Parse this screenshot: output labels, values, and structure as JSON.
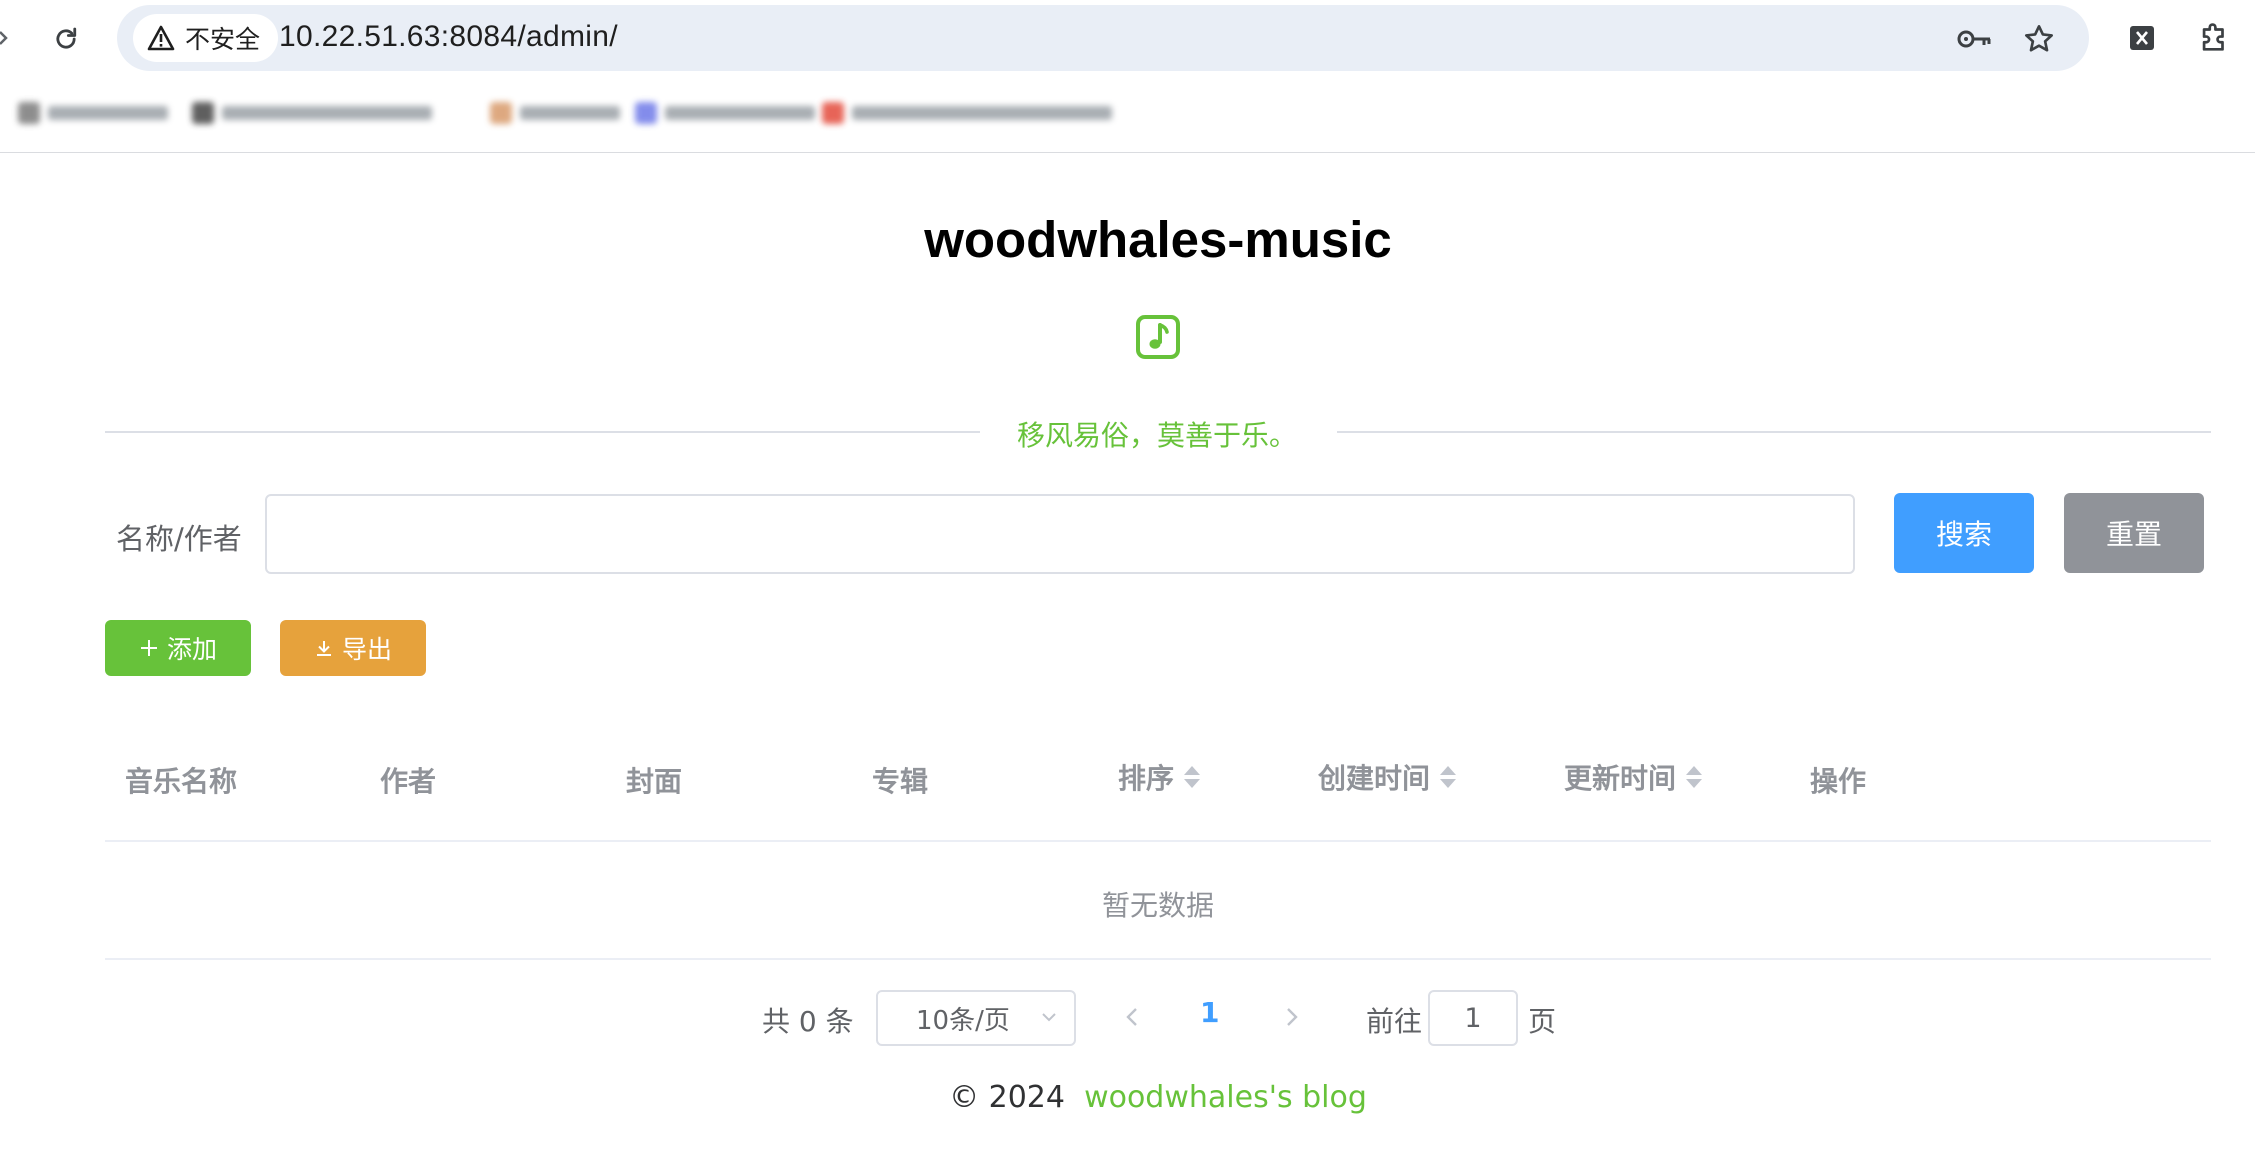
{
  "browser": {
    "security_label": "不安全",
    "url": "10.22.51.63:8084/admin/"
  },
  "site": {
    "title": "woodwhales-music",
    "motto": "移风易俗，莫善于乐。"
  },
  "search": {
    "label": "名称/作者",
    "value": "",
    "placeholder": "",
    "search_button": "搜索",
    "reset_button": "重置"
  },
  "actions": {
    "add_button": "添加",
    "export_button": "导出"
  },
  "table": {
    "columns": [
      "音乐名称",
      "作者",
      "封面",
      "专辑",
      "排序",
      "创建时间",
      "更新时间",
      "操作"
    ],
    "sortable": [
      false,
      false,
      false,
      false,
      true,
      true,
      true,
      false
    ],
    "rows": [],
    "empty_text": "暂无数据"
  },
  "pagination": {
    "total_label": "共 0 条",
    "page_size": "10条/页",
    "current_page": "1",
    "goto_label": "前往",
    "jump_value": "1",
    "unit_label": "页"
  },
  "footer": {
    "copyright": "©  2024",
    "link_text": "woodwhales's blog"
  },
  "colors": {
    "primary": "#409eff",
    "success": "#67c23a",
    "warning": "#e6a23c",
    "info": "#909399"
  }
}
